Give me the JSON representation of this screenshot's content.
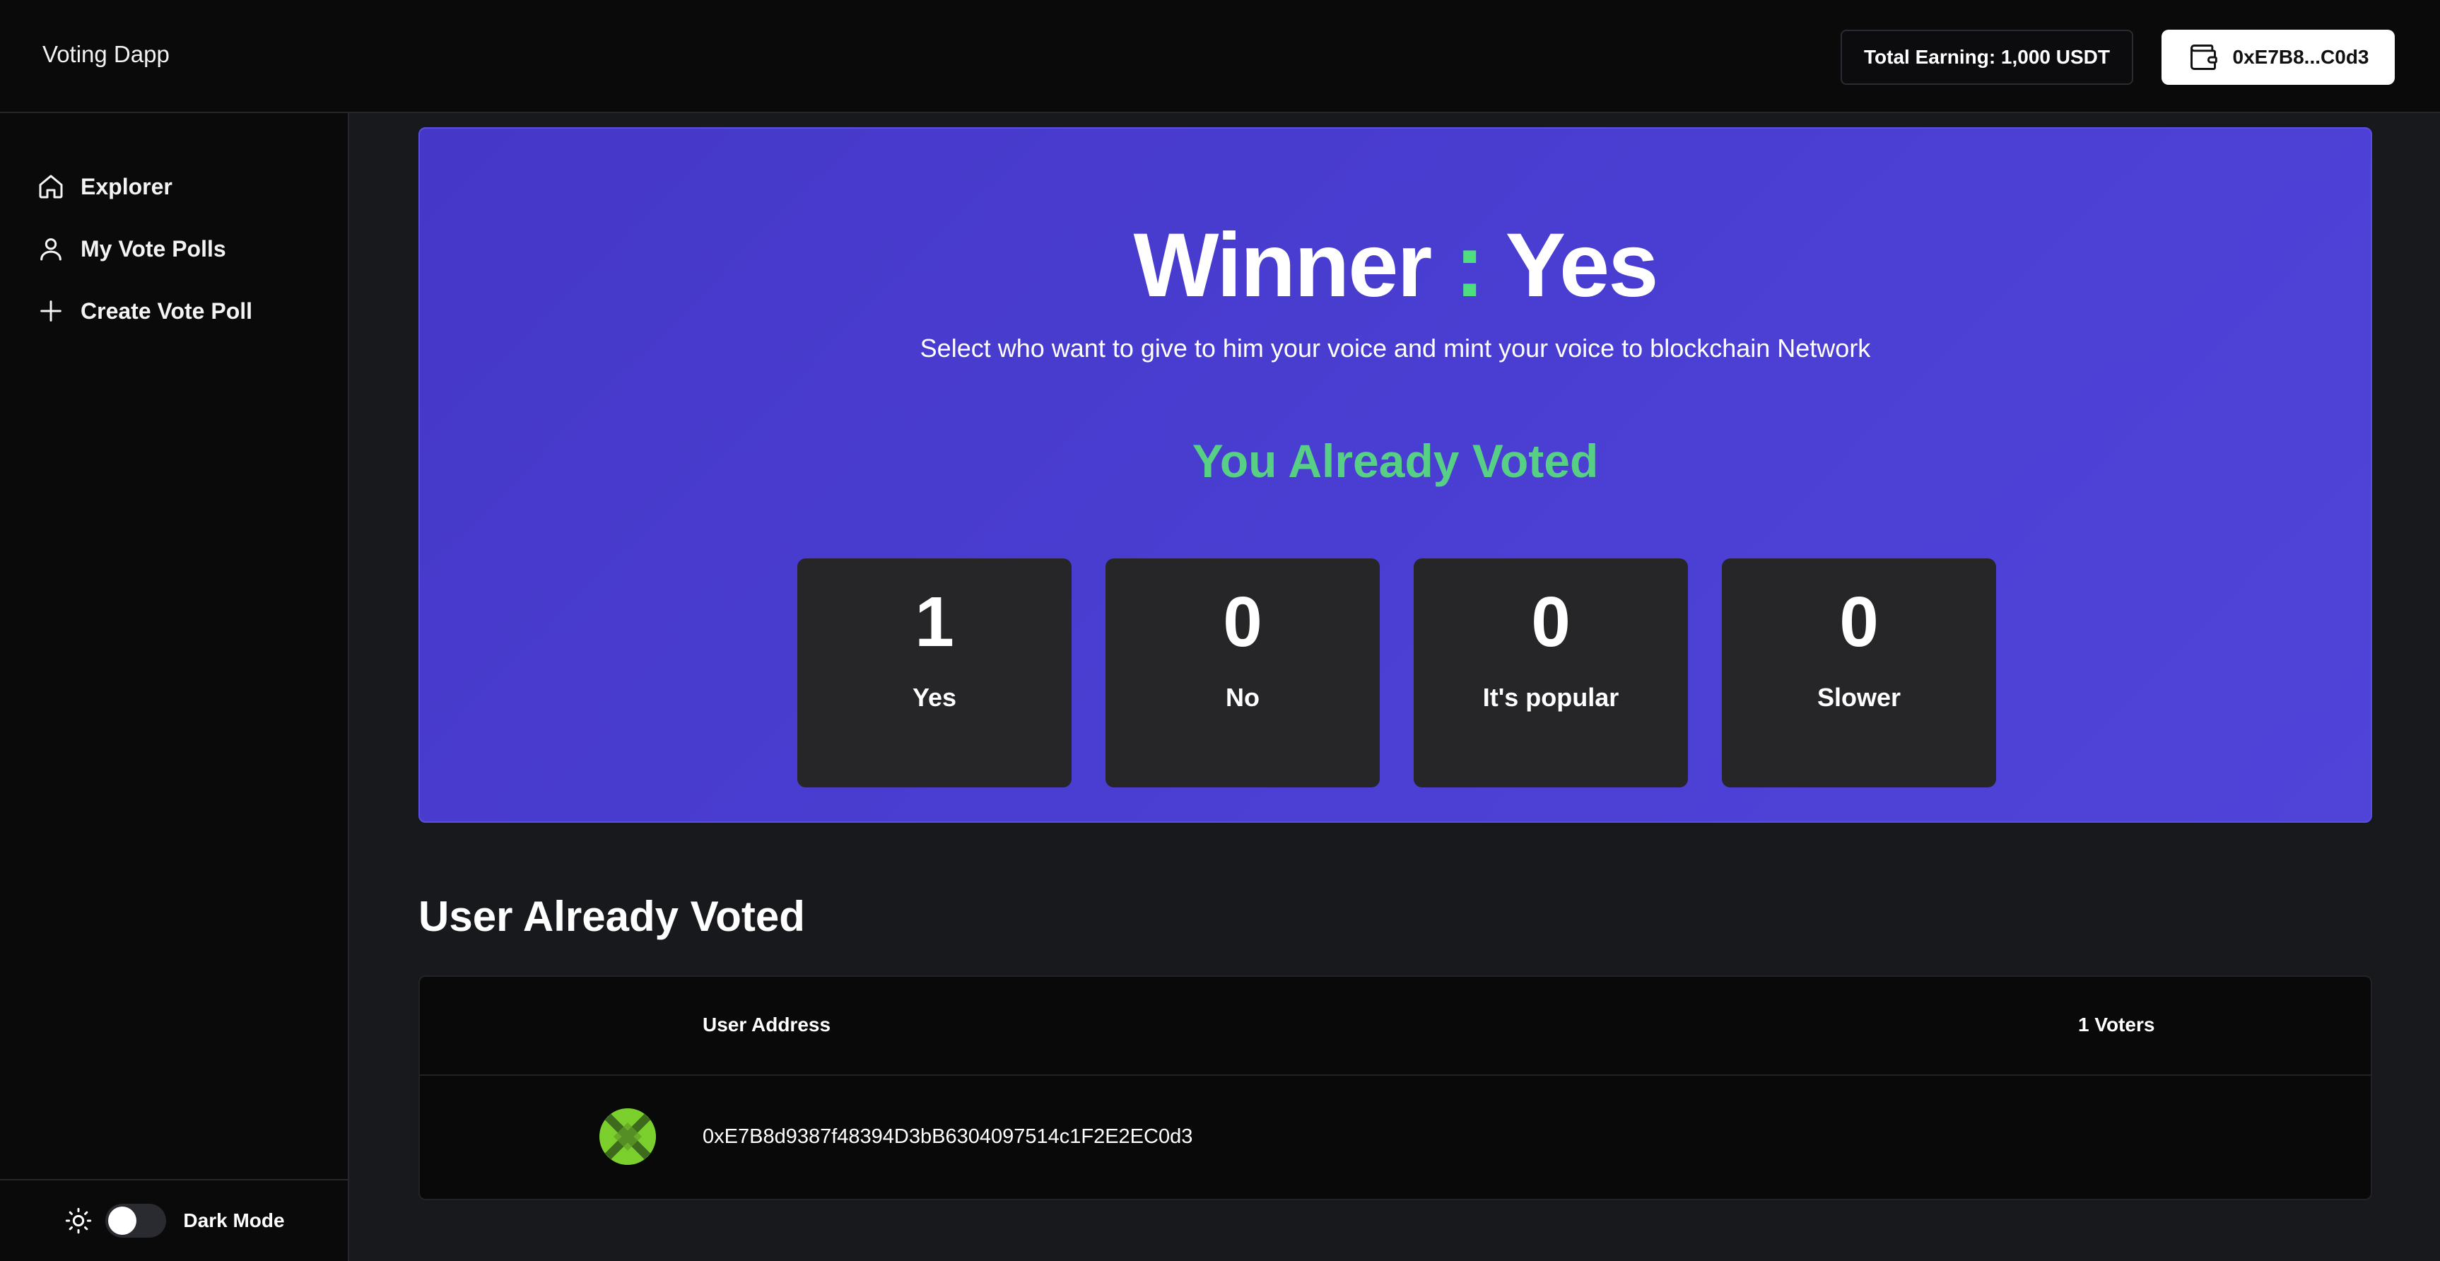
{
  "app": {
    "brand": "Voting Dapp"
  },
  "header": {
    "earning_label": "Total Earning: 1,000 USDT",
    "wallet_address": "0xE7B8...C0d3"
  },
  "sidebar": {
    "items": [
      {
        "label": "Explorer",
        "icon": "home-icon"
      },
      {
        "label": "My Vote Polls",
        "icon": "user-icon"
      },
      {
        "label": "Create Vote Poll",
        "icon": "plus-icon"
      }
    ],
    "theme_toggle_label": "Dark Mode",
    "theme_toggle_on": false
  },
  "poll": {
    "winner_prefix": "Winner",
    "winner_colon": ":",
    "winner_value": "Yes",
    "subtitle": "Select who want to give to him your voice and mint your voice to blockchain Network",
    "voted_notice": "You Already Voted",
    "options": [
      {
        "count": "1",
        "label": "Yes"
      },
      {
        "count": "0",
        "label": "No"
      },
      {
        "count": "0",
        "label": "It's popular"
      },
      {
        "count": "0",
        "label": "Slower"
      }
    ]
  },
  "voters": {
    "title": "User Already Voted",
    "column_address": "User Address",
    "column_count": "1 Voters",
    "rows": [
      {
        "address": "0xE7B8d9387f48394D3bB6304097514c1F2E2EC0d3"
      }
    ]
  },
  "colors": {
    "hero_bg": "#4b3fd2",
    "accent_green": "#4ede80",
    "card_bg": "#262628",
    "avatar_green": "#7bd02d"
  }
}
